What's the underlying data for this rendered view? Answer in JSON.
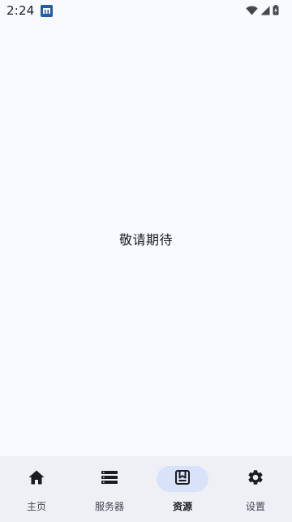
{
  "status_bar": {
    "time": "2:24",
    "app_icon": "notification-app-icon",
    "wifi_icon": "wifi-icon",
    "signal_icon": "cellular-signal-icon",
    "battery_icon": "battery-charging-icon"
  },
  "content": {
    "placeholder": "敬请期待"
  },
  "bottom_nav": {
    "items": [
      {
        "label": "主页",
        "icon": "home-icon",
        "active": false
      },
      {
        "label": "服务器",
        "icon": "server-list-icon",
        "active": false
      },
      {
        "label": "资源",
        "icon": "bookmark-box-icon",
        "active": true
      },
      {
        "label": "设置",
        "icon": "gear-icon",
        "active": false
      }
    ]
  },
  "colors": {
    "background": "#f9fafe",
    "nav_background": "#eef0f5",
    "active_indicator": "#d8e2f8",
    "text": "#1b1c1f"
  }
}
